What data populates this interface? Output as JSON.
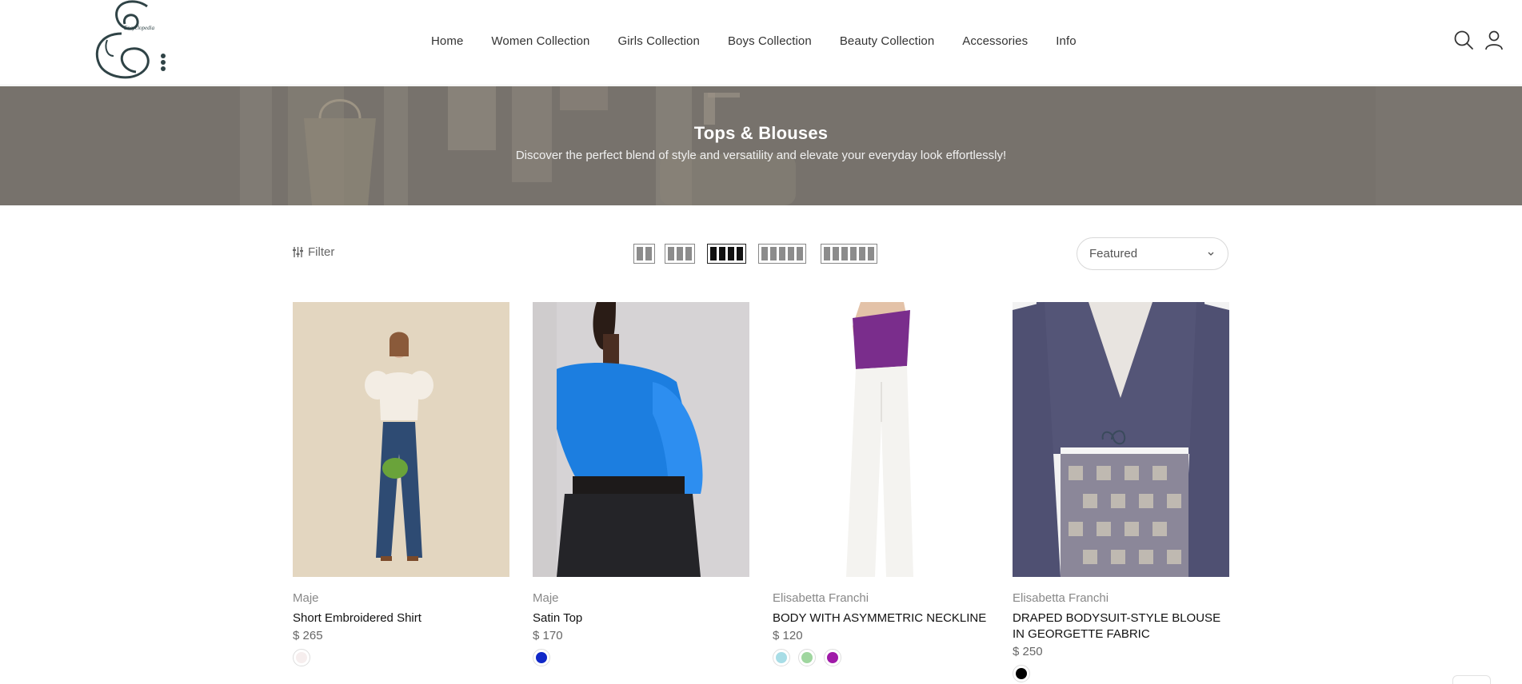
{
  "header": {
    "logo_text": "Encyclopedia",
    "nav": [
      "Home",
      "Women Collection",
      "Girls Collection",
      "Boys Collection",
      "Beauty Collection",
      "Accessories",
      "Info"
    ],
    "icons": [
      "search-icon",
      "user-icon"
    ]
  },
  "banner": {
    "title": "Tops & Blouses",
    "subtitle": "Discover the perfect blend of style and versatility and elevate your everyday look effortlessly!"
  },
  "toolbar": {
    "filter_label": "Filter",
    "grid_options": [
      2,
      3,
      4,
      5,
      6
    ],
    "grid_active": 4,
    "sort_value": "Featured"
  },
  "products": [
    {
      "brand": "Maje",
      "name": "Short Embroidered Shirt",
      "price": "$ 265",
      "swatches": [
        "#f6eeee"
      ]
    },
    {
      "brand": "Maje",
      "name": "Satin Top",
      "price": "$ 170",
      "swatches": [
        "#1028c8"
      ]
    },
    {
      "brand": "Elisabetta Franchi",
      "name": "BODY WITH ASYMMETRIC NECKLINE",
      "price": "$ 120",
      "swatches": [
        "#a8dde6",
        "#9fd69f",
        "#a01aa8"
      ]
    },
    {
      "brand": "Elisabetta Franchi",
      "name": "DRAPED BODYSUIT-STYLE BLOUSE IN GEORGETTE FABRIC",
      "price": "$ 250",
      "swatches": [
        "#000000"
      ]
    }
  ],
  "colors": {
    "banner_bg": "#7b7670",
    "accent_text": "#111111"
  }
}
